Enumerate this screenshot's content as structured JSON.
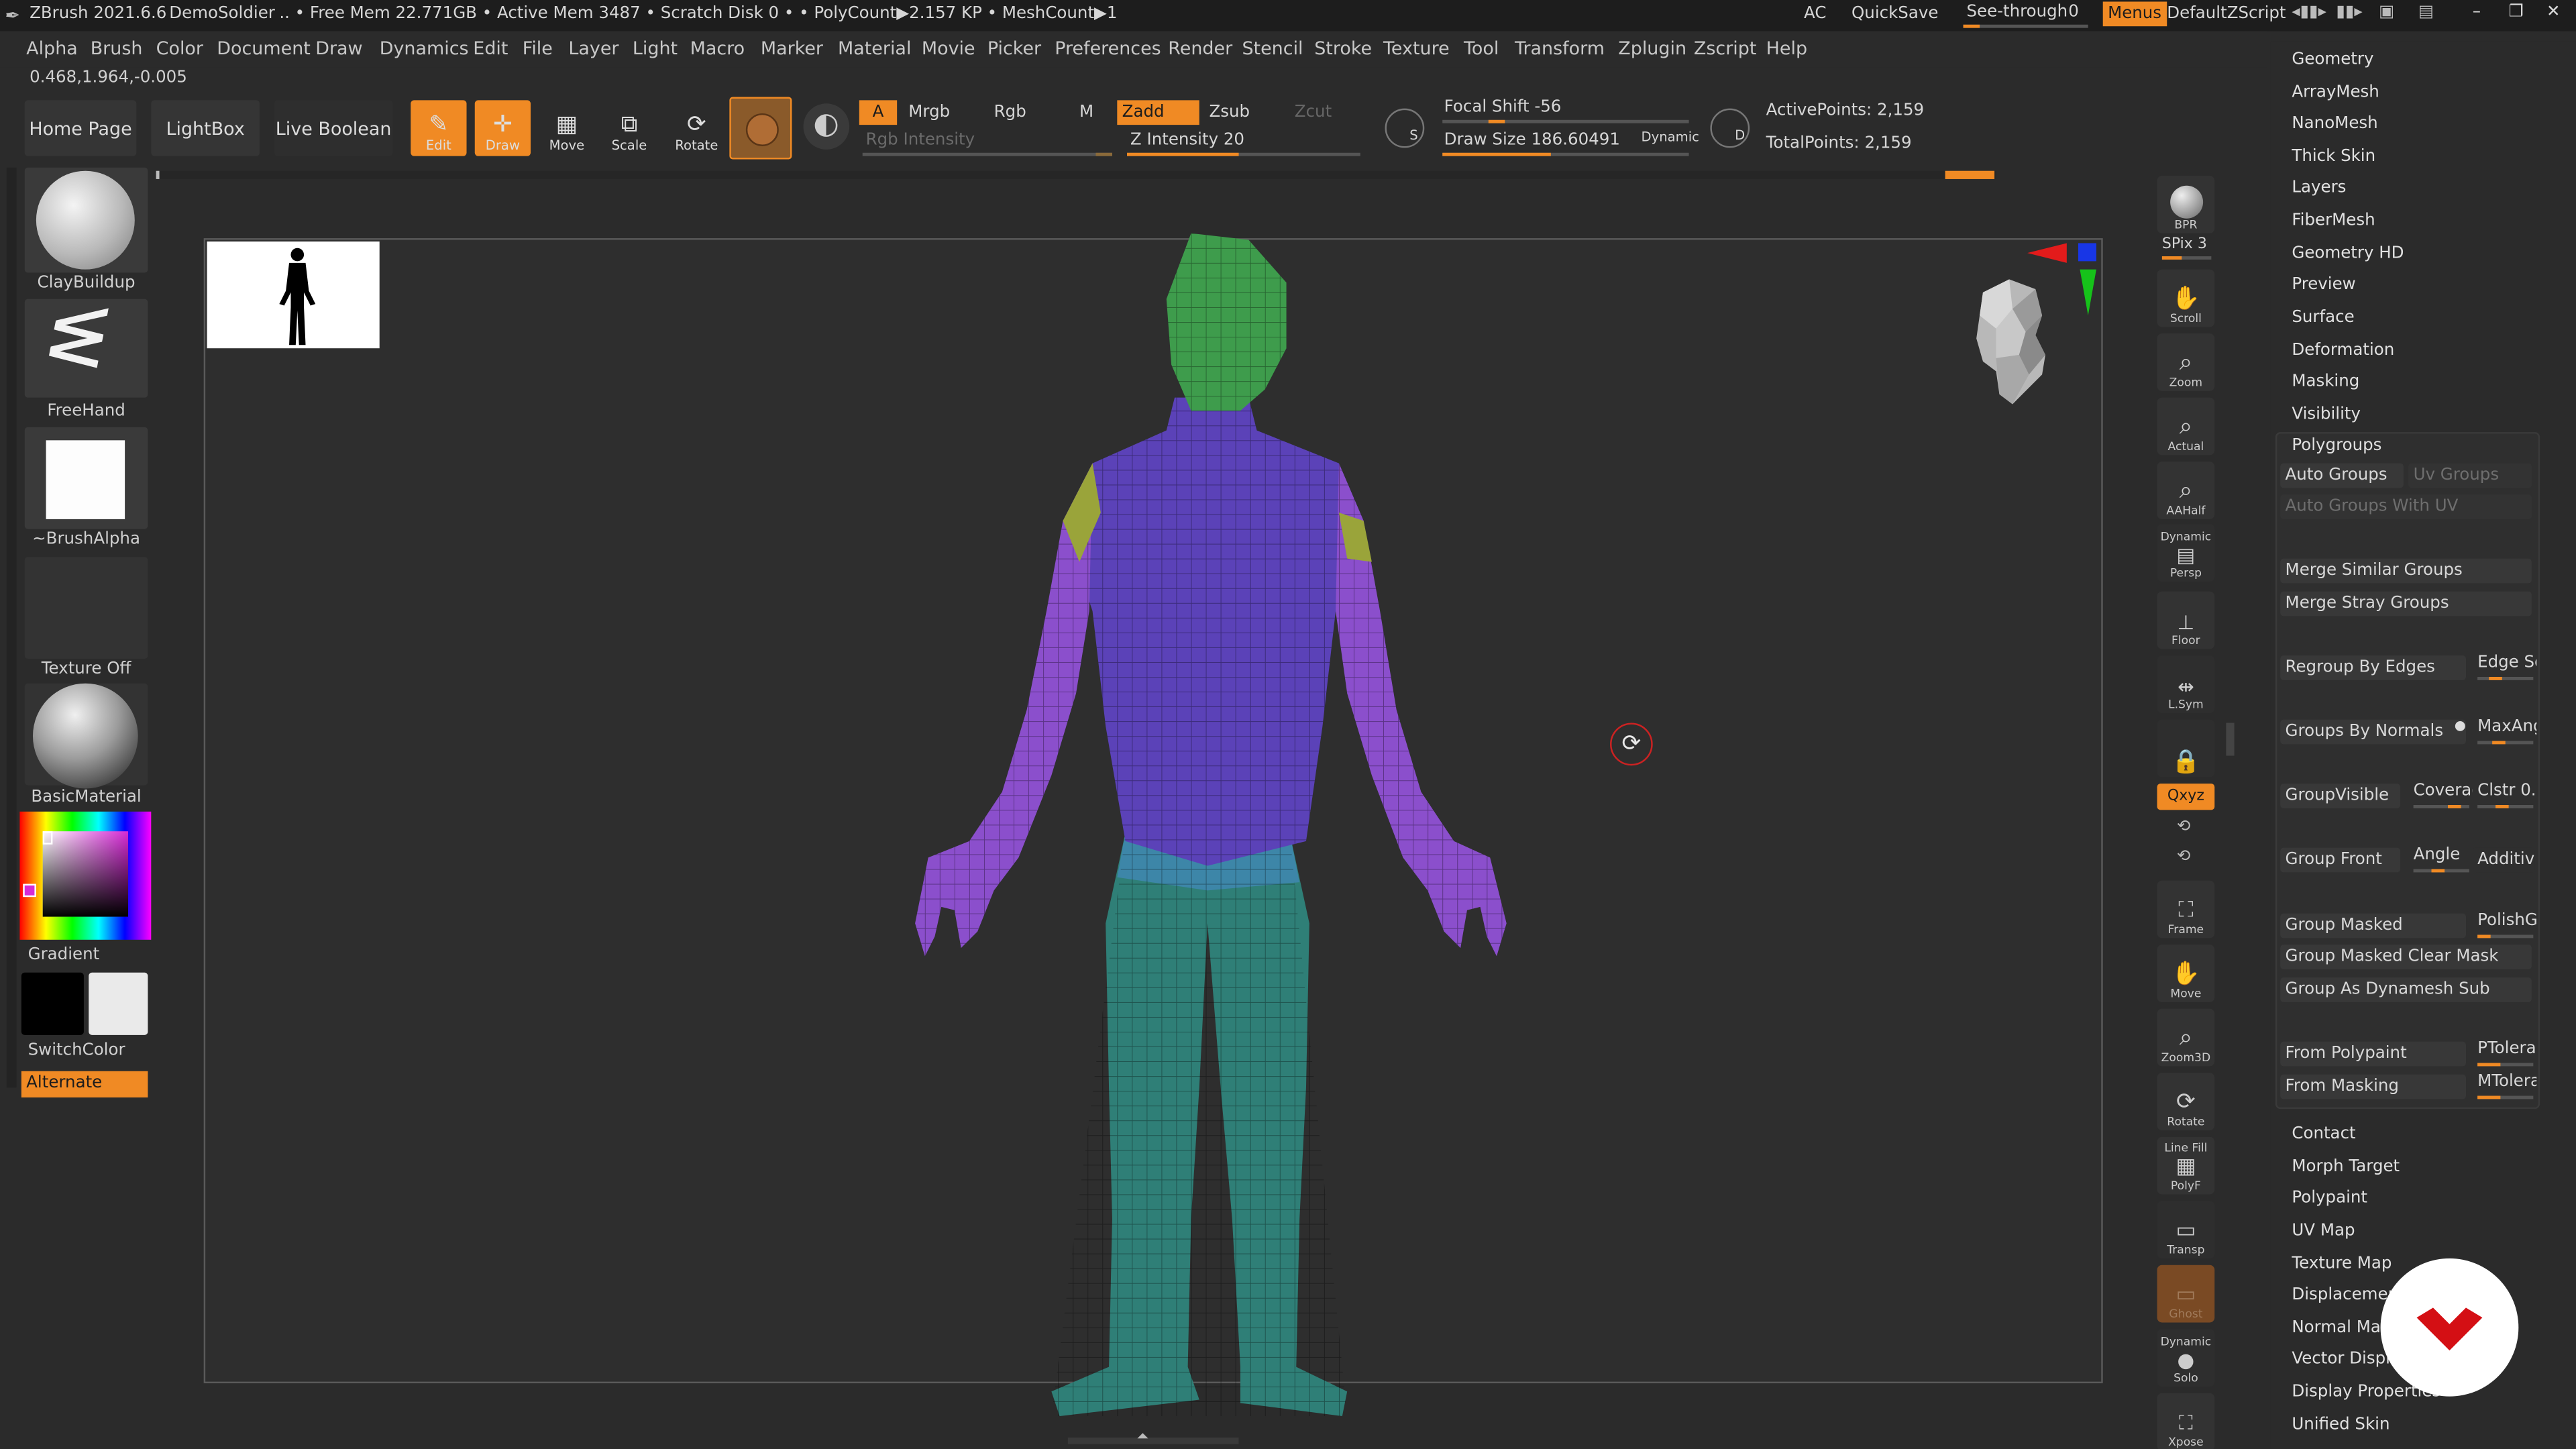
{
  "title_bar": {
    "app": "ZBrush 2021.6.6",
    "project": "DemoSoldier",
    "stats": ".. • Free Mem 22.771GB • Active Mem 3487 • Scratch Disk 0 •  • PolyCount▶2.157 KP  • MeshCount▶1",
    "ac": "AC",
    "quicksave": "QuickSave",
    "see_through_label": "See-through",
    "see_through_value": "0",
    "menus": "Menus",
    "script": "DefaultZScript"
  },
  "menu_items": [
    "Alpha",
    "Brush",
    "Color",
    "Document",
    "Draw",
    "Dynamics",
    "Edit",
    "File",
    "Layer",
    "Light",
    "Macro",
    "Marker",
    "Material",
    "Movie",
    "Picker",
    "Preferences",
    "Render",
    "Stencil",
    "Stroke",
    "Texture",
    "Tool",
    "Transform",
    "Zplugin",
    "Zscript",
    "Help"
  ],
  "coords": "0.468,1.964,-0.005",
  "shelf": {
    "home_page": "Home Page",
    "lightbox": "LightBox",
    "live_boolean": "Live Boolean",
    "edit": "Edit",
    "draw": "Draw",
    "move": "Move",
    "scale": "Scale",
    "rotate": "Rotate",
    "a": "A",
    "mrgb": "Mrgb",
    "rgb": "Rgb",
    "m": "M",
    "zadd": "Zadd",
    "zsub": "Zsub",
    "zcut": "Zcut",
    "rgb_intensity": "Rgb Intensity",
    "z_intensity": "Z Intensity 20",
    "focal_shift": "Focal Shift -56",
    "draw_size": "Draw Size 186.60491",
    "dynamic": "Dynamic",
    "active_points": "ActivePoints: 2,159",
    "total_points": "TotalPoints: 2,159"
  },
  "left_shelf": {
    "brush": "ClayBuildup",
    "stroke": "FreeHand",
    "alpha": "~BrushAlpha",
    "texture": "Texture Off",
    "material": "BasicMaterial",
    "gradient": "Gradient",
    "switch_color": "SwitchColor",
    "alternate": "Alternate"
  },
  "right_shelf": {
    "bpr": "BPR",
    "spix": "SPix 3",
    "scroll": "Scroll",
    "zoom": "Zoom",
    "actual": "Actual",
    "aahalf": "AAHalf",
    "persp_top": "Dynamic",
    "persp": "Persp",
    "floor": "Floor",
    "lsym": "L.Sym",
    "xyz": "Qxyz",
    "frame": "Frame",
    "move": "Move",
    "zoom3d": "Zoom3D",
    "rotate": "Rotate",
    "linefill_top": "Line Fill",
    "polyf": "PolyF",
    "transp": "Transp",
    "ghost": "Ghost",
    "solo_top": "Dynamic",
    "solo": "Solo",
    "xpose": "Xpose"
  },
  "tool_panel": {
    "top_items": [
      "Geometry",
      "ArrayMesh",
      "NanoMesh",
      "Thick Skin",
      "Layers",
      "FiberMesh",
      "Geometry HD",
      "Preview",
      "Surface",
      "Deformation",
      "Masking",
      "Visibility"
    ],
    "polygroups_title": "Polygroups",
    "auto_groups": "Auto Groups",
    "uv_groups": "Uv Groups",
    "auto_groups_uv": "Auto Groups With UV",
    "merge_similar": "Merge Similar Groups",
    "merge_stray": "Merge Stray Groups",
    "regroup_edges": "Regroup By Edges",
    "edge_se": "Edge Se",
    "groups_normals": "Groups By Normals",
    "maxang": "MaxAng",
    "group_visible": "GroupVisible",
    "coverage": "Coverag",
    "clstr": "Clstr 0.",
    "group_front": "Group Front",
    "angle": "Angle",
    "additive": "Additive",
    "group_masked": "Group Masked",
    "polishg": "PolishG",
    "group_masked_clear": "Group Masked Clear Mask",
    "group_dynamesh": "Group As Dynamesh Sub",
    "from_polypaint": "From Polypaint",
    "ptolera": "PTolera",
    "from_masking": "From Masking",
    "mtolera": "MTolera",
    "bottom_items": [
      "Contact",
      "Morph Target",
      "Polypaint",
      "UV Map",
      "Texture Map",
      "Displacement Map",
      "Normal Map",
      "Vector Displacement Map",
      "Display Properties",
      "Unified Skin"
    ]
  },
  "colors": {
    "accent": "#f08a24",
    "head_group": "#3e9c4c",
    "torso_group": "#5b42b8",
    "arm_group": "#8b4fcc",
    "shoulder_group": "#9aa43a",
    "leg_group": "#2f7f77",
    "hip_group": "#3d86a8"
  }
}
